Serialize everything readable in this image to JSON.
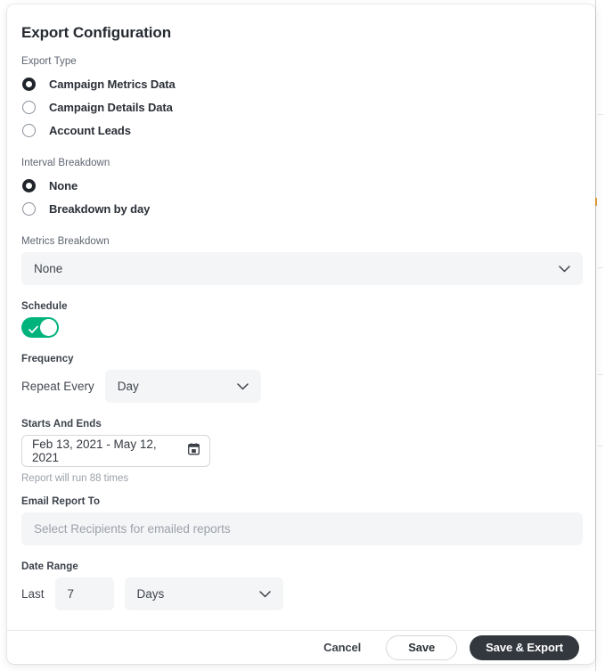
{
  "modal": {
    "title": "Export Configuration",
    "export_type": {
      "label": "Export Type",
      "options": [
        {
          "label": "Campaign Metrics Data",
          "selected": true
        },
        {
          "label": "Campaign Details Data",
          "selected": false
        },
        {
          "label": "Account Leads",
          "selected": false
        }
      ]
    },
    "interval_breakdown": {
      "label": "Interval Breakdown",
      "options": [
        {
          "label": "None",
          "selected": true
        },
        {
          "label": "Breakdown by day",
          "selected": false
        }
      ]
    },
    "metrics_breakdown": {
      "label": "Metrics Breakdown",
      "value": "None"
    },
    "schedule": {
      "label": "Schedule",
      "enabled": true
    },
    "frequency": {
      "label": "Frequency",
      "repeat_label": "Repeat Every",
      "value": "Day"
    },
    "starts_and_ends": {
      "label": "Starts And Ends",
      "value": "Feb 13, 2021 - May 12, 2021",
      "hint": "Report will run 88 times"
    },
    "email_report_to": {
      "label": "Email Report To",
      "placeholder": "Select Recipients for emailed reports",
      "value": ""
    },
    "date_range": {
      "label": "Date Range",
      "prefix": "Last",
      "amount": "7",
      "unit": "Days"
    },
    "footer": {
      "cancel_label": "Cancel",
      "save_label": "Save",
      "save_export_label": "Save & Export"
    }
  },
  "colors": {
    "toggle_on": "#00b37d",
    "primary_button": "#33383f",
    "field_background": "#f4f5f7",
    "marker": "#e8a33d"
  }
}
